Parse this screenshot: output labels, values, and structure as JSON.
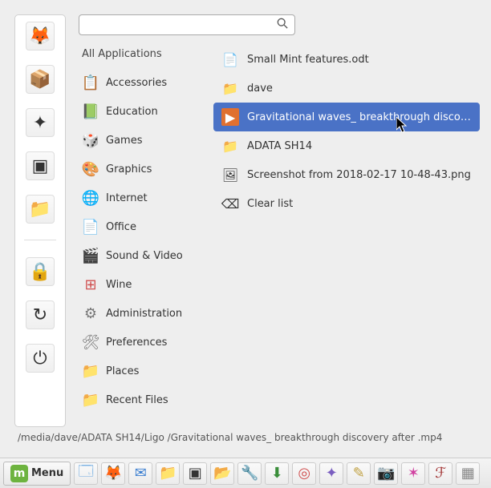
{
  "search": {
    "placeholder": ""
  },
  "categories_header": "All Applications",
  "categories": [
    {
      "name": "accessories",
      "label": "Accessories",
      "glyph": "📋",
      "color": "#c08040"
    },
    {
      "name": "education",
      "label": "Education",
      "glyph": "📗",
      "color": "#3a8e3a"
    },
    {
      "name": "games",
      "label": "Games",
      "glyph": "🎲",
      "color": "#888"
    },
    {
      "name": "graphics",
      "label": "Graphics",
      "glyph": "🎨",
      "color": "#d05050"
    },
    {
      "name": "internet",
      "label": "Internet",
      "glyph": "🌐",
      "color": "#3a7ed0"
    },
    {
      "name": "office",
      "label": "Office",
      "glyph": "📄",
      "color": "#888"
    },
    {
      "name": "sound-video",
      "label": "Sound & Video",
      "glyph": "🎬",
      "color": "#3a8e3a"
    },
    {
      "name": "wine",
      "label": "Wine",
      "glyph": "⊞",
      "color": "#d05050"
    },
    {
      "name": "administration",
      "label": "Administration",
      "glyph": "⚙",
      "color": "#777"
    },
    {
      "name": "preferences",
      "label": "Preferences",
      "glyph": "🛠",
      "color": "#777"
    },
    {
      "name": "places",
      "label": "Places",
      "glyph": "📁",
      "color": "#6aa8e0"
    },
    {
      "name": "recent-files",
      "label": "Recent Files",
      "glyph": "📁",
      "color": "#6aa8e0"
    }
  ],
  "results": [
    {
      "name": "small-mint-features",
      "label": "Small Mint features.odt",
      "glyph": "📄",
      "selected": false
    },
    {
      "name": "folder-dave",
      "label": "dave",
      "glyph": "📁",
      "selected": false
    },
    {
      "name": "gravitational-waves",
      "label": "Gravitational waves_ breakthrough disco…",
      "glyph": "▶",
      "selected": true
    },
    {
      "name": "adata-sh14",
      "label": "ADATA SH14",
      "glyph": "📁",
      "selected": false
    },
    {
      "name": "screenshot",
      "label": "Screenshot from 2018-02-17 10-48-43.png",
      "glyph": "🖼",
      "selected": false
    },
    {
      "name": "clear-list",
      "label": "Clear list",
      "glyph": "⌫",
      "selected": false
    }
  ],
  "favorites": [
    {
      "name": "firefox",
      "glyph": "🦊"
    },
    {
      "name": "package",
      "glyph": "📦"
    },
    {
      "name": "software",
      "glyph": "✦"
    },
    {
      "name": "terminal",
      "glyph": "▣"
    },
    {
      "name": "files",
      "glyph": "📁"
    }
  ],
  "system_favorites": [
    {
      "name": "lock",
      "glyph": "🔒"
    },
    {
      "name": "logout",
      "glyph": "↻"
    },
    {
      "name": "shutdown",
      "glyph": "⏻"
    }
  ],
  "taskbar": {
    "menu_label": "Menu",
    "items": [
      {
        "name": "show-desktop",
        "glyph": "🗔",
        "color": "#6aa8e0"
      },
      {
        "name": "firefox",
        "glyph": "🦊",
        "color": "#e07030"
      },
      {
        "name": "thunderbird",
        "glyph": "✉",
        "color": "#3a7ed0"
      },
      {
        "name": "files",
        "glyph": "📁",
        "color": "#c08040"
      },
      {
        "name": "terminal",
        "glyph": "▣",
        "color": "#333"
      },
      {
        "name": "files2",
        "glyph": "📂",
        "color": "#c08040"
      },
      {
        "name": "tools",
        "glyph": "🔧",
        "color": "#777"
      },
      {
        "name": "torrent",
        "glyph": "⬇",
        "color": "#3a8e3a"
      },
      {
        "name": "chrome",
        "glyph": "◎",
        "color": "#d05050"
      },
      {
        "name": "compass",
        "glyph": "✦",
        "color": "#7a5ec0"
      },
      {
        "name": "notes",
        "glyph": "✎",
        "color": "#c0a040"
      },
      {
        "name": "camera",
        "glyph": "📷",
        "color": "#333"
      },
      {
        "name": "app-pink",
        "glyph": "✶",
        "color": "#d040a0"
      },
      {
        "name": "app-red",
        "glyph": "ℱ",
        "color": "#a03030"
      },
      {
        "name": "calendar",
        "glyph": "▦",
        "color": "#888"
      }
    ]
  },
  "status_path": "/media/dave/ADATA SH14/Ligo /Gravitational waves_ breakthrough discovery after .mp4"
}
